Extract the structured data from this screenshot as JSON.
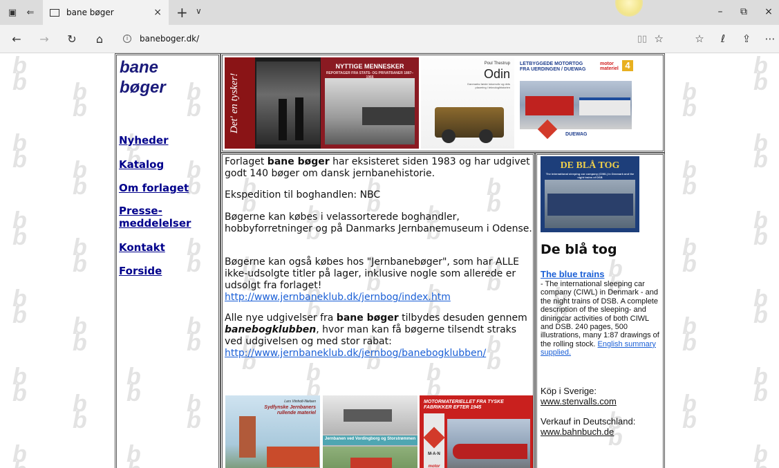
{
  "browser": {
    "tab_title": "bane bøger",
    "url": "baneboger.dk/",
    "tab_close": "×",
    "newtab": "+",
    "tablist": "∨",
    "win_min": "–",
    "win_restore": "⧉",
    "win_close": "×"
  },
  "nav": {
    "logo_line1": "bane",
    "logo_line2": "bøger",
    "items": [
      "Nyheder",
      "Katalog",
      "Om forlaget",
      "Presse-",
      "meddelelser",
      "Kontakt",
      "Forside"
    ]
  },
  "covers": {
    "c1_spine": "Det' en tysker!",
    "c2_title": "NYTTIGE MENNESKER",
    "c2_sub": "REPORTAGER FRA STATS- OG PRIVATBANER 1887–1966",
    "c3_author": "Poul Thestrup",
    "c3_title": "Odin",
    "c3_sub": "Danmarks første lokomotiv og dets placering i teknologihistorien",
    "c4_title": "LETBYGGEDE MOTORTOG FRA UERDINGEN / DUEWAG",
    "c4_brand": "motor materiel",
    "c4_num": "4",
    "c4_duewag": "DUEWAG",
    "side_title": "DE BLÅ TOG",
    "side_sub": "The international sleeping car company (CIWL) in Denmark and the night trains of DSB",
    "b1_author": "Lars Viinholt-Nielsen",
    "b1_title": "Sydfynske Jernbaners rullende materiel",
    "b2_title": "Jernbanen ved Vordingborg og Storstrømmen",
    "b3_title": "MOTORMATERIELLET FRA TYSKE FABRIKKER EFTER 1945",
    "b3_brand": "M·A·N",
    "b3_brand2": "motor"
  },
  "content": {
    "p1_a": "Forlaget ",
    "p1_b": "bane bøger",
    "p1_c": " har eksisteret siden 1983 og har udgivet godt 140 bøger om dansk jernbanehistorie.",
    "p2": "Ekspedition til boghandlen: NBC",
    "p3": "Bøgerne kan købes i velassorterede boghandler, hobbyforretninger og på Danmarks Jernbanemuseum i Odense.",
    "p4": "Bøgerne kan også købes hos \"Jernbanebøger\", som har ALLE ikke-udsolgte titler på lager, inklusive nogle som allerede er udsolgt fra forlaget!",
    "link1": "http://www.jernbaneklub.dk/jernbog/index.htm",
    "p5_a": "Alle nye udgivelser fra ",
    "p5_b": "bane bøger",
    "p5_c": " tilbydes desuden gennem ",
    "p5_d": "banebogklubben",
    "p5_e": ", hvor man kan få bøgerne tilsendt straks ved udgivelsen og med stor rabat:",
    "link2": "http://www.jernbaneklub.dk/jernbog/banebogklubben/"
  },
  "sidebar": {
    "heading": "De blå tog",
    "subheading": "The blue trains",
    "desc": "- The international sleeping car company (CIWL) in Denmark - and the night trains of DSB. A complete description of the sleeping- and diningcar activities of both CIWL and DSB. 240 pages, 500 illustrations, many 1:87 drawings of the rolling stock.",
    "summary_link": "English summary supplied.",
    "sweden_label": "Köp i Sverige:",
    "sweden_link": "www.stenvalls.com",
    "germany_label": "Verkauf in Deutschland:",
    "germany_link": "www.bahnbuch.de"
  }
}
